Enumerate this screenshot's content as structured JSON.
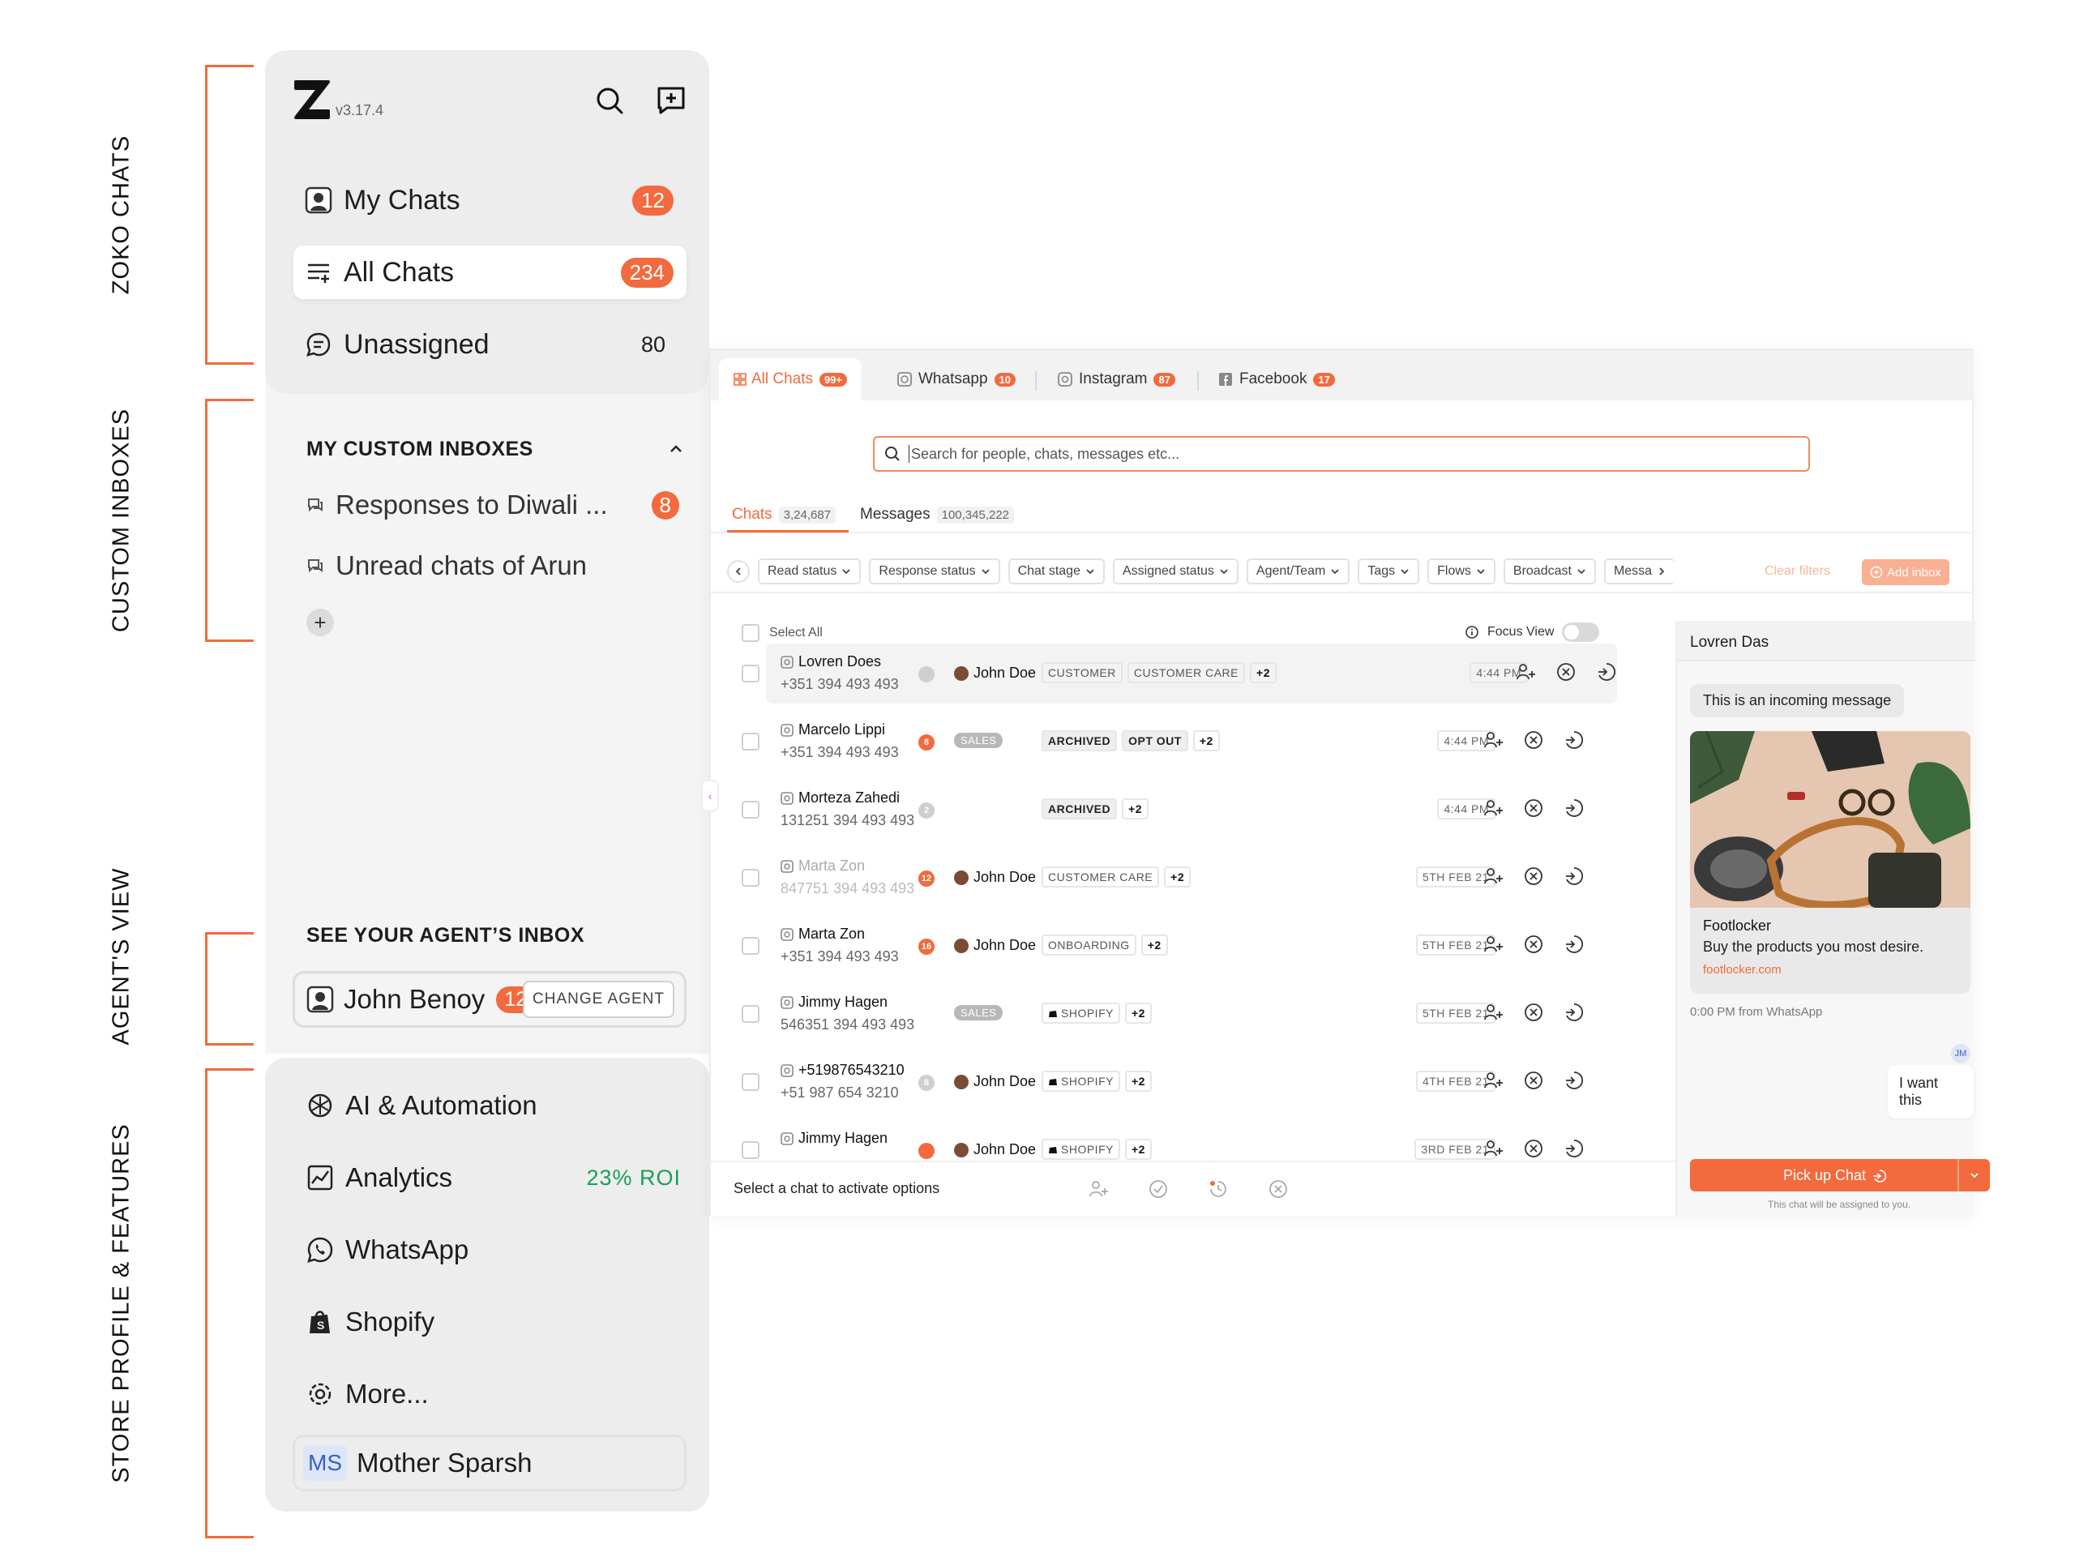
{
  "annotations": {
    "zoko_chats": "ZOKO CHATS",
    "custom_inboxes": "CUSTOM INBOXES",
    "agents_view": "AGENT'S VIEW",
    "store_profile": "STORE PROFILE &  FEATURES"
  },
  "sidebar": {
    "version": "v3.17.4",
    "nav": [
      {
        "label": "My Chats",
        "count": "12"
      },
      {
        "label": "All Chats",
        "count": "234"
      },
      {
        "label": "Unassigned",
        "count": "80"
      }
    ],
    "custom_inboxes_title": "MY CUSTOM INBOXES",
    "custom_inboxes": [
      {
        "label": "Responses to Diwali ...",
        "count": "8"
      },
      {
        "label": "Unread chats of Arun"
      }
    ],
    "agent_section_title": "SEE YOUR AGENT’S INBOX",
    "agent": {
      "name": "John Benoy",
      "count": "12",
      "change_label": "CHANGE  AGENT"
    },
    "features": [
      {
        "label": "AI & Automation"
      },
      {
        "label": "Analytics",
        "extra": "23%  ROI"
      },
      {
        "label": "WhatsApp"
      },
      {
        "label": "Shopify"
      },
      {
        "label": "More..."
      }
    ],
    "profile": {
      "initials": "MS",
      "name": "Mother Sparsh"
    }
  },
  "tabs": [
    {
      "label": "All Chats",
      "badge": "99+"
    },
    {
      "label": "Whatsapp",
      "badge": "10"
    },
    {
      "label": "Instagram",
      "badge": "87"
    },
    {
      "label": "Facebook",
      "badge": "17"
    }
  ],
  "search": {
    "placeholder": "Search for people, chats, messages etc..."
  },
  "subtabs": [
    {
      "label": "Chats",
      "count": "3,24,687"
    },
    {
      "label": "Messages",
      "count": "100,345,222"
    }
  ],
  "filters": [
    "Read status",
    "Response status",
    "Chat stage",
    "Assigned status",
    "Agent/Team",
    "Tags",
    "Flows",
    "Broadcast",
    "Messa"
  ],
  "clear_filters": "Clear filters",
  "add_inbox": "Add inbox",
  "select_all": "Select All",
  "focus_view": "Focus View",
  "rows": [
    {
      "name": "Lovren Does",
      "phone": "+351 394 493 493",
      "dot": "",
      "dot_color": "#cfcfcf",
      "agent": "John Doe",
      "sales": "",
      "tags": [
        "CUSTOMER",
        "CUSTOMER CARE",
        "+2"
      ],
      "dark_tags": [],
      "time": "4:44 PM",
      "muted": false
    },
    {
      "name": "Marcelo Lippi",
      "phone": "+351 394 493 493",
      "dot": "8",
      "dot_color": "#f26a3d",
      "agent": "",
      "sales": "SALES",
      "tags": [
        "+2"
      ],
      "dark_tags": [
        "ARCHIVED",
        "OPT OUT"
      ],
      "time": "4:44 PM",
      "muted": false
    },
    {
      "name": "Morteza Zahedi",
      "phone": "131251 394 493 493",
      "dot": "2",
      "dot_color": "#cfcfcf",
      "agent": "",
      "sales": "",
      "tags": [
        "+2"
      ],
      "dark_tags": [
        "ARCHIVED"
      ],
      "time": "4:44 PM",
      "muted": false
    },
    {
      "name": "Marta Zon",
      "phone": "847751 394 493 493",
      "dot": "12",
      "dot_color": "#f26a3d",
      "agent": "John Doe",
      "sales": "",
      "tags": [
        "CUSTOMER CARE",
        "+2"
      ],
      "dark_tags": [],
      "time": "5TH FEB 21",
      "muted": true
    },
    {
      "name": "Marta Zon",
      "phone": "+351 394 493 493",
      "dot": "16",
      "dot_color": "#f26a3d",
      "agent": "John Doe",
      "sales": "",
      "tags": [
        "ONBOARDING",
        "+2"
      ],
      "dark_tags": [],
      "time": "5TH FEB 21",
      "muted": false
    },
    {
      "name": "Jimmy Hagen",
      "phone": "546351 394 493 493",
      "dot": "",
      "dot_color": "",
      "agent": "",
      "sales": "SALES",
      "tags": [
        "SHOPIFY",
        "+2"
      ],
      "dark_tags": [],
      "time": "5TH FEB 21",
      "muted": false
    },
    {
      "name": "+519876543210",
      "phone": "+51 987 654 3210",
      "dot": "8",
      "dot_color": "#cfcfcf",
      "agent": "John Doe",
      "sales": "",
      "tags": [
        "SHOPIFY",
        "+2"
      ],
      "dark_tags": [],
      "time": "4TH FEB 21",
      "muted": false
    },
    {
      "name": "Jimmy Hagen",
      "phone": "",
      "dot": "",
      "dot_color": "#f26a3d",
      "agent": "John Doe",
      "sales": "",
      "tags": [
        "SHOPIFY",
        "+2"
      ],
      "dark_tags": [],
      "time": "3RD FEB 21",
      "muted": false
    }
  ],
  "bottom_bar": {
    "text": "Select a chat to activate options"
  },
  "preview": {
    "name": "Lovren Das",
    "incoming": "This is an incoming message",
    "card_title": "Footlocker",
    "card_desc": "Buy the products you most desire.",
    "card_link": "footlocker.com",
    "meta": "0:00 PM from WhatsApp",
    "avatar": "JM",
    "outgoing": "I want this",
    "pick_label": "Pick up Chat",
    "note": "This chat will be assigned to you."
  },
  "colors": {
    "accent": "#f26a3d",
    "roi": "#1aa056"
  }
}
